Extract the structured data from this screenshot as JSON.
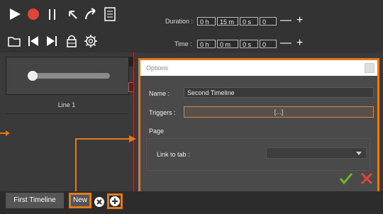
{
  "toolbar": {
    "duration_label": "Duration :",
    "duration": {
      "h": "0 h",
      "m": "15 m",
      "s": "0 s",
      "ms": "0"
    },
    "time_label": "Time :",
    "time": {
      "h": "0 h",
      "m": "0 m",
      "s": "0 s",
      "ms": "0"
    },
    "minus": "—",
    "plus": "+"
  },
  "timeline": {
    "line_label": "Line 1",
    "slider_value": 0
  },
  "dialog": {
    "title": "Options",
    "name_label": "Name :",
    "name_value": "Second Timeline",
    "triggers_label": "Triggers :",
    "triggers_button": "[...]",
    "page_label": "Page",
    "link_label": "Link to tab :",
    "link_value": ""
  },
  "tabs": [
    {
      "label": "First Timeline"
    },
    {
      "label": "New"
    }
  ],
  "colors": {
    "accent": "#e07a1f",
    "ok": "#6fb52c",
    "cancel": "#e0443a",
    "record": "#e0443a"
  }
}
